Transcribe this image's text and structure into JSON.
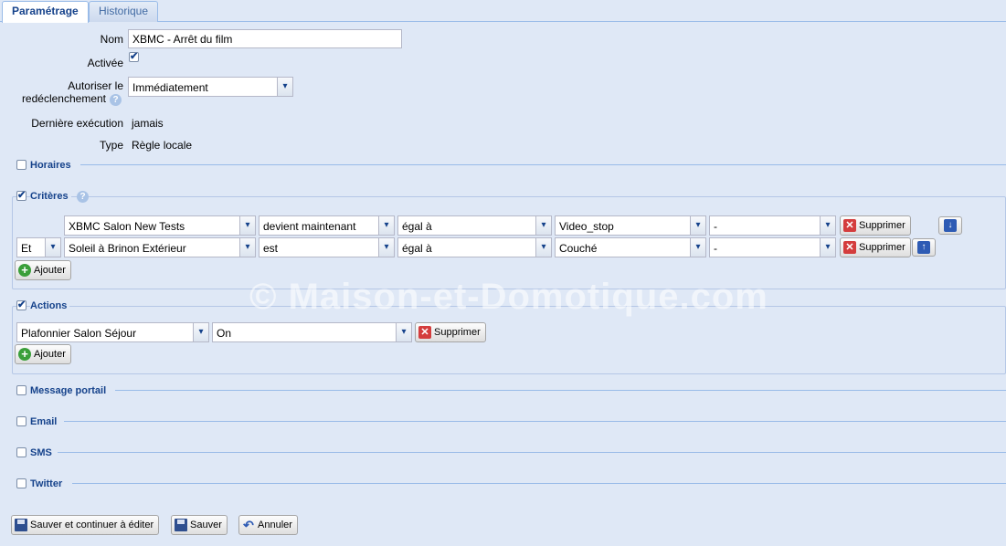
{
  "tabs": [
    {
      "label": "Paramétrage"
    },
    {
      "label": "Historique"
    }
  ],
  "form": {
    "nom_label": "Nom",
    "nom_value": "XBMC - Arrêt du film",
    "activee_label": "Activée",
    "redecl_label_1": "Autoriser le",
    "redecl_label_2": "redéclenchement",
    "redecl_value": "Immédiatement",
    "derniere_label": "Dernière exécution",
    "derniere_value": "jamais",
    "type_label": "Type",
    "type_value": "Règle locale"
  },
  "sections": {
    "horaires": "Horaires",
    "criteres": "Critères",
    "actions": "Actions",
    "message": "Message portail",
    "email": "Email",
    "sms": "SMS",
    "twitter": "Twitter"
  },
  "criteres": {
    "rows": [
      {
        "connector": "",
        "device": "XBMC Salon New Tests",
        "condition": "devient maintenant",
        "operator": "égal à",
        "value": "Video_stop",
        "extra": "-",
        "delete_label": "Supprimer"
      },
      {
        "connector": "Et",
        "device": "Soleil à Brinon Extérieur",
        "condition": "est",
        "operator": "égal à",
        "value": "Couché",
        "extra": "-",
        "delete_label": "Supprimer"
      }
    ],
    "add_label": "Ajouter"
  },
  "actions": {
    "rows": [
      {
        "device": "Plafonnier Salon Séjour",
        "command": "On",
        "delete_label": "Supprimer"
      }
    ],
    "add_label": "Ajouter"
  },
  "footer": {
    "save_continue": "Sauver et continuer à éditer",
    "save": "Sauver",
    "cancel": "Annuler"
  },
  "watermark": "© Maison-et-Domotique.com",
  "icons": {
    "checkbox_checked": "✔",
    "combo_trigger": "chevron-down-icon",
    "help": "?"
  }
}
